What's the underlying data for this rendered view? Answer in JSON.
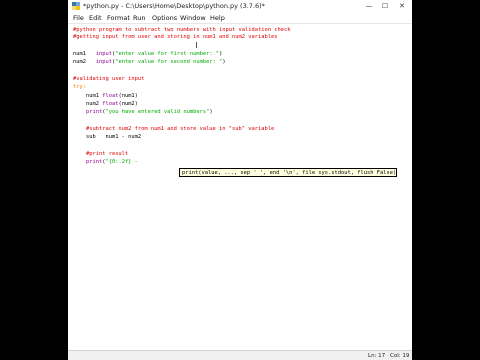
{
  "window": {
    "title": "*python.py - C:\\Users\\Home\\Desktop\\python.py (3.7.6)*",
    "minimize_glyph": "—",
    "maximize_glyph": "☐",
    "close_glyph": "✕"
  },
  "menu": [
    "File",
    "Edit",
    "Format",
    "Run",
    "Options",
    "Window",
    "Help"
  ],
  "code": {
    "l1": "#python program to subtract two numbers with input validation check",
    "l2": "#getting input from user and storing in num1 and num2 variables",
    "l3_a": "num1   ",
    "l3_b": "input",
    "l3_c": "(",
    "l3_d": "\"enter value for first number: \"",
    "l3_e": ")",
    "l4_a": "num2   ",
    "l4_b": "input",
    "l4_c": "(",
    "l4_d": "\"enter value for second number: \"",
    "l4_e": ")",
    "l5": "#validating user input",
    "l6": "try:",
    "l7_a": "    num1 ",
    "l7_b": "float",
    "l7_c": "(num1)",
    "l8_a": "    num2 ",
    "l8_b": "float",
    "l8_c": "(num2)",
    "l9_a": "    ",
    "l9_b": "print",
    "l9_c": "(",
    "l9_d": "\"you have entered valid numbers\"",
    "l9_e": ")",
    "l10": "    #subtract num2 from num1 and store value in \"sub\" variable",
    "l11": "    sub   num1 - num2",
    "l12": "    #print result",
    "l13_a": "    ",
    "l13_b": "print",
    "l13_c": "(",
    "l13_d": "\"{0:.2f} -",
    "calltip": "print(value, ..., sep ' ', end '\\n', file sys.stdout, flush False)"
  },
  "status": {
    "line": "Ln: 17",
    "col": "Col: 19"
  }
}
